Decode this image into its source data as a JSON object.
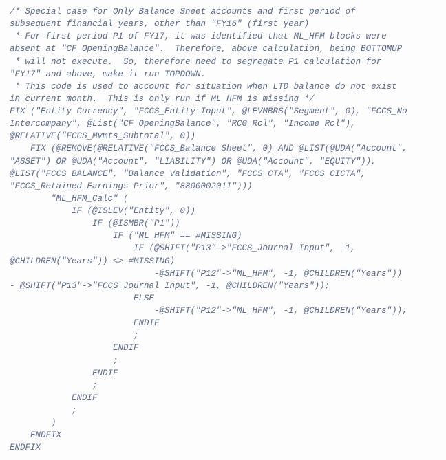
{
  "code": {
    "lines": [
      "/* Special case for Only Balance Sheet accounts and first period of",
      "subsequent financial years, other than \"FY16\" (first year)",
      " * For first period P1 of FY17, it was identified that ML_HFM blocks were",
      "absent at \"CF_OpeningBalance\".  Therefore, above calculation, being BOTTOMUP",
      " * will not execute.  So, therefore need to segregate P1 calculation for",
      "\"FY17\" and above, make it run TOPDOWN.",
      " * This code is used to account for situation when LTD balance do not exist",
      "in current month.  This is only run if ML_HFM is missing */",
      "FIX (\"Entity Currency\", \"FCCS_Entity Input\", @LEVMBRS(\"Segment\", 0), \"FCCS_No",
      "Intercompany\", @List(\"CF_OpeningBalance\", \"RCG_Rcl\", \"Income_Rcl\"),",
      "@RELATIVE(\"FCCS_Mvmts_Subtotal\", 0))",
      "    FIX (@REMOVE(@RELATIVE(\"FCCS_Balance Sheet\", 0) AND @LIST(@UDA(\"Account\",",
      "\"ASSET\") OR @UDA(\"Account\", \"LIABILITY\") OR @UDA(\"Account\", \"EQUITY\")),",
      "@LIST(\"FCCS_BALANCE\", \"Balance_Validation\", \"FCCS_CTA\", \"FCCS_CICTA\",",
      "\"FCCS_Retained Earnings Prior\", \"880000201I\")))",
      "        \"ML_HFM_Calc\" (",
      "            IF (@ISLEV(\"Entity\", 0))",
      "                IF (@ISMBR(\"P1\"))",
      "                    IF (\"ML_HFM\" == #MISSING)",
      "                        IF (@SHIFT(\"P13\"->\"FCCS_Journal Input\", -1,",
      "@CHILDREN(\"Years\")) <> #MISSING)",
      "                            -@SHIFT(\"P12\"->\"ML_HFM\", -1, @CHILDREN(\"Years\"))",
      "- @SHIFT(\"P13\"->\"FCCS_Journal Input\", -1, @CHILDREN(\"Years\"));",
      "                        ELSE",
      "                            -@SHIFT(\"P12\"->\"ML_HFM\", -1, @CHILDREN(\"Years\"));",
      "                        ENDIF",
      "                        ;",
      "                    ENDIF",
      "                    ;",
      "                ENDIF",
      "                ;",
      "            ENDIF",
      "            ;",
      "        )",
      "    ENDFIX",
      "ENDFIX"
    ]
  }
}
